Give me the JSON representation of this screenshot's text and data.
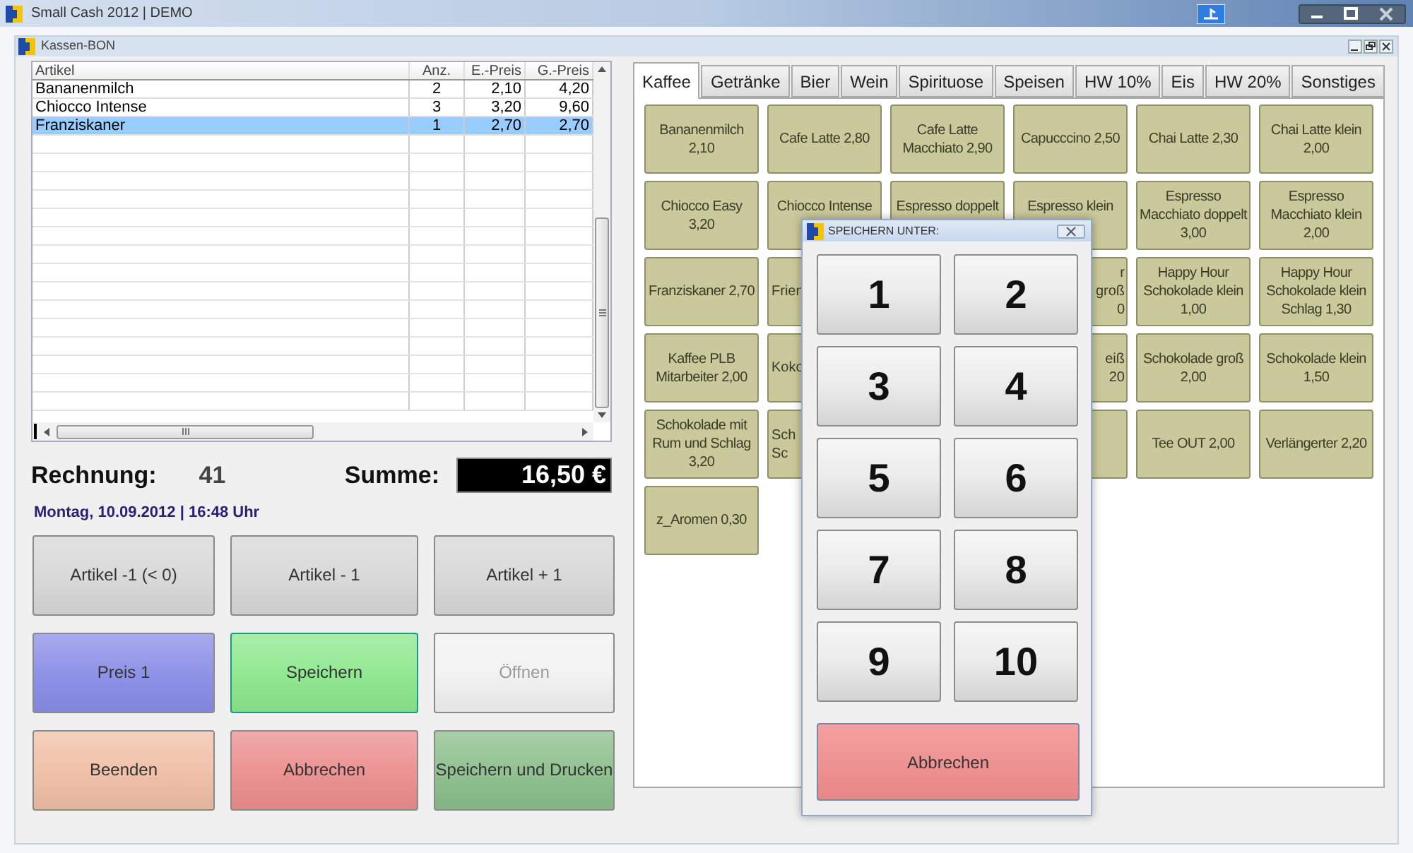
{
  "window": {
    "title": "Small Cash 2012 | DEMO"
  },
  "child_window": {
    "title": "Kassen-BON"
  },
  "receipt_table": {
    "columns": [
      "Artikel",
      "Anz.",
      "E.-Preis",
      "G.-Preis"
    ],
    "rows": [
      {
        "cells": [
          "Bananenmilch",
          "2",
          "2,10",
          "4,20"
        ],
        "selected": false
      },
      {
        "cells": [
          "Chiocco Intense",
          "3",
          "3,20",
          "9,60"
        ],
        "selected": false
      },
      {
        "cells": [
          "Franziskaner",
          "1",
          "2,70",
          "2,70"
        ],
        "selected": true
      }
    ]
  },
  "invoice": {
    "label": "Rechnung:",
    "number": "41"
  },
  "total": {
    "label": "Summe:",
    "value": "16,50 €"
  },
  "datetime": "Montag, 10.09.2012 | 16:48 Uhr",
  "actions": [
    {
      "label": "Artikel -1 (< 0)",
      "color": "#d8d8d8",
      "disabled": false,
      "focused": false
    },
    {
      "label": "Artikel - 1",
      "color": "#d8d8d8",
      "disabled": false,
      "focused": false
    },
    {
      "label": "Artikel + 1",
      "color": "#d8d8d8",
      "disabled": false,
      "focused": false
    },
    {
      "label": "Preis 1",
      "color": "#8a8ee6",
      "disabled": false,
      "focused": false
    },
    {
      "label": "Speichern",
      "color": "#8de88d",
      "disabled": false,
      "focused": true
    },
    {
      "label": "Öffnen",
      "color": "#f2f2f2",
      "disabled": true,
      "focused": false
    },
    {
      "label": "Beenden",
      "color": "#f0bfa6",
      "disabled": false,
      "focused": false
    },
    {
      "label": "Abbrechen",
      "color": "#ec8e8e",
      "disabled": false,
      "focused": false
    },
    {
      "label": "Speichern und Drucken",
      "color": "#8cbf8c",
      "disabled": false,
      "focused": false
    }
  ],
  "tabs": [
    {
      "label": "Kaffee",
      "selected": true
    },
    {
      "label": "Getränke",
      "selected": false
    },
    {
      "label": "Bier",
      "selected": false
    },
    {
      "label": "Wein",
      "selected": false
    },
    {
      "label": "Spirituose",
      "selected": false
    },
    {
      "label": "Speisen",
      "selected": false
    },
    {
      "label": "HW 10%",
      "selected": false
    },
    {
      "label": "Eis",
      "selected": false
    },
    {
      "label": "HW 20%",
      "selected": false
    },
    {
      "label": "Sonstiges",
      "selected": false
    }
  ],
  "products": [
    {
      "kind": "full",
      "lines": [
        "Bananenmilch",
        "2,10"
      ]
    },
    {
      "kind": "full",
      "lines": [
        "Cafe Latte 2,80"
      ]
    },
    {
      "kind": "full",
      "lines": [
        "Cafe Latte",
        "Macchiato 2,90"
      ]
    },
    {
      "kind": "full",
      "lines": [
        "Capucccino 2,50"
      ]
    },
    {
      "kind": "full",
      "lines": [
        "Chai Latte 2,30"
      ]
    },
    {
      "kind": "full",
      "lines": [
        "Chai Latte klein",
        "2,00"
      ]
    },
    {
      "kind": "full",
      "lines": [
        "Chiocco Easy",
        "3,20"
      ]
    },
    {
      "kind": "cut_bottom",
      "lines": [
        "Chiocco Intense"
      ]
    },
    {
      "kind": "cut_bottom",
      "lines": [
        "Espresso doppelt"
      ]
    },
    {
      "kind": "cut_bottom",
      "lines": [
        "Espresso klein"
      ]
    },
    {
      "kind": "full",
      "lines": [
        "Espresso",
        "Macchiato doppelt",
        "3,00"
      ]
    },
    {
      "kind": "full",
      "lines": [
        "Espresso",
        "Macchiato klein",
        "2,00"
      ]
    },
    {
      "kind": "full",
      "lines": [
        "Franziskaner 2,70"
      ]
    },
    {
      "kind": "cut_left",
      "lines": [
        "Frien"
      ]
    },
    {
      "kind": "cut_right",
      "lines": [
        "r",
        "groß",
        "0"
      ]
    },
    {
      "kind": "full",
      "lines": [
        "Happy Hour",
        "Schokolade klein",
        "1,00"
      ]
    },
    {
      "kind": "full",
      "lines": [
        "Happy Hour",
        "Schokolade klein",
        "Schlag 1,30"
      ]
    },
    {
      "kind": "full",
      "lines": [
        "Kaffee PLB",
        "Mitarbeiter 2,00"
      ]
    },
    {
      "kind": "cut_left",
      "lines": [
        "Koko"
      ]
    },
    {
      "kind": "cut_right",
      "lines": [
        "eiß",
        "20"
      ]
    },
    {
      "kind": "full",
      "lines": [
        "Schokolade groß",
        "2,00"
      ]
    },
    {
      "kind": "full",
      "lines": [
        "Schokolade klein",
        "1,50"
      ]
    },
    {
      "kind": "full",
      "lines": [
        "Schokolade mit",
        "Rum und Schlag",
        "3,20"
      ]
    },
    {
      "kind": "cut_left",
      "lines": [
        "Sch",
        "Sc"
      ]
    },
    {
      "kind": "cut_right"
    },
    {
      "kind": "full",
      "lines": [
        "Tee OUT 2,00"
      ]
    },
    {
      "kind": "full",
      "lines": [
        "Verlängerter 2,20"
      ]
    },
    {
      "kind": "full",
      "lines": [
        "z_Aromen 0,30"
      ]
    }
  ],
  "dialog": {
    "title": "SPEICHERN UNTER:",
    "keys": [
      "1",
      "2",
      "3",
      "4",
      "5",
      "6",
      "7",
      "8",
      "9",
      "10"
    ],
    "cancel": "Abbrechen"
  }
}
